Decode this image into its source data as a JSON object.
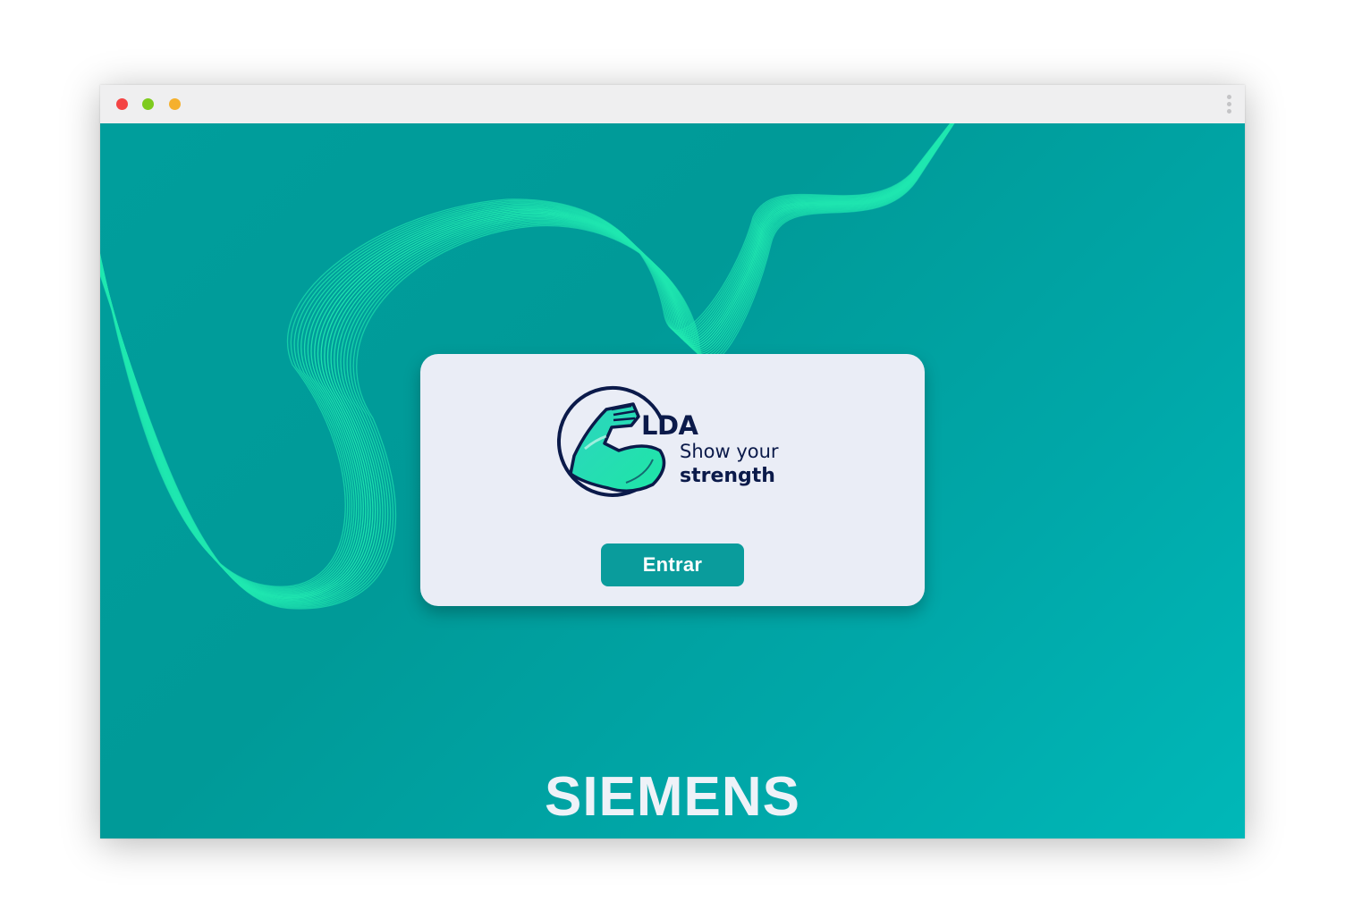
{
  "window": {
    "controls": [
      "close",
      "maximize",
      "minimize"
    ],
    "menu_icon": "kebab-menu-icon"
  },
  "card": {
    "logo": {
      "title": "LDA",
      "subtitle_line1": "Show your",
      "subtitle_line2": "strength",
      "emblem_icon": "flexed-arm-icon"
    },
    "enter_label": "Entrar"
  },
  "footer": {
    "brand": "SIEMENS"
  },
  "colors": {
    "background": "#00a0a0",
    "wave": "#20e8b0",
    "card": "#eaedf6",
    "button": "#0a9c9c",
    "logo_text": "#0b1a4a",
    "brand_text": "#eef2f8"
  }
}
